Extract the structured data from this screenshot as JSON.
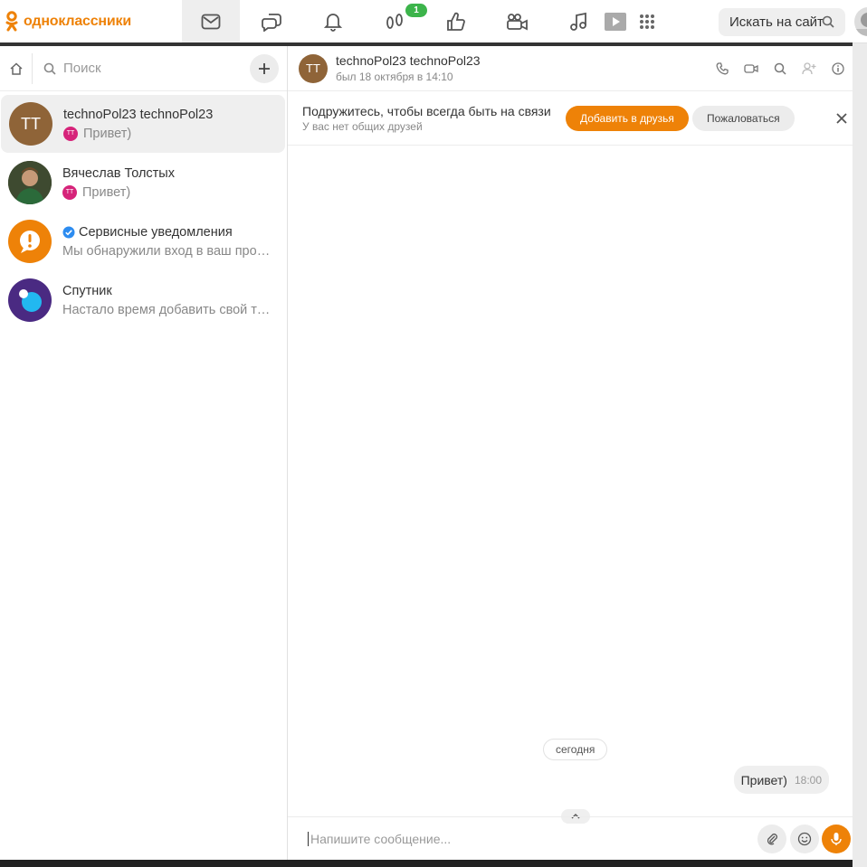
{
  "topbar": {
    "brand": "одноклассники",
    "notifications_badge": "1",
    "search_placeholder": "Искать на сайт"
  },
  "sidebar": {
    "search_placeholder": "Поиск",
    "chats": [
      {
        "initials": "TT",
        "name": "technoPol23 technoPol23",
        "preview": "Привет)",
        "preview_badge": "TT",
        "avatar_color": "#8f6438"
      },
      {
        "name": "Вячеслав Толстых",
        "preview": "Привет)",
        "preview_badge": "TT",
        "avatar_color": "#3b4a2a"
      },
      {
        "name": "Сервисные уведомления",
        "preview": "Мы обнаружили вход в ваш профиль",
        "verified": true,
        "avatar_color": "#ee8208"
      },
      {
        "name": "Спутник",
        "preview": "Настало время добавить свой текст",
        "avatar_color": "#4a2a82"
      }
    ]
  },
  "conversation": {
    "initials": "TT",
    "name": "technoPol23 technoPol23",
    "status": "был 18 октября в 14:10",
    "friend_prompt": {
      "title": "Подружитесь, чтобы всегда быть на связи",
      "subtitle": "У вас нет общих друзей",
      "add_button": "Добавить в друзья",
      "report_button": "Пожаловаться"
    },
    "date_separator": "сегодня",
    "messages": [
      {
        "text": "Привет)",
        "time": "18:00"
      }
    ],
    "composer_placeholder": "Напишите сообщение..."
  },
  "colors": {
    "accent": "#ee8208",
    "badge_green": "#3cb44b"
  }
}
